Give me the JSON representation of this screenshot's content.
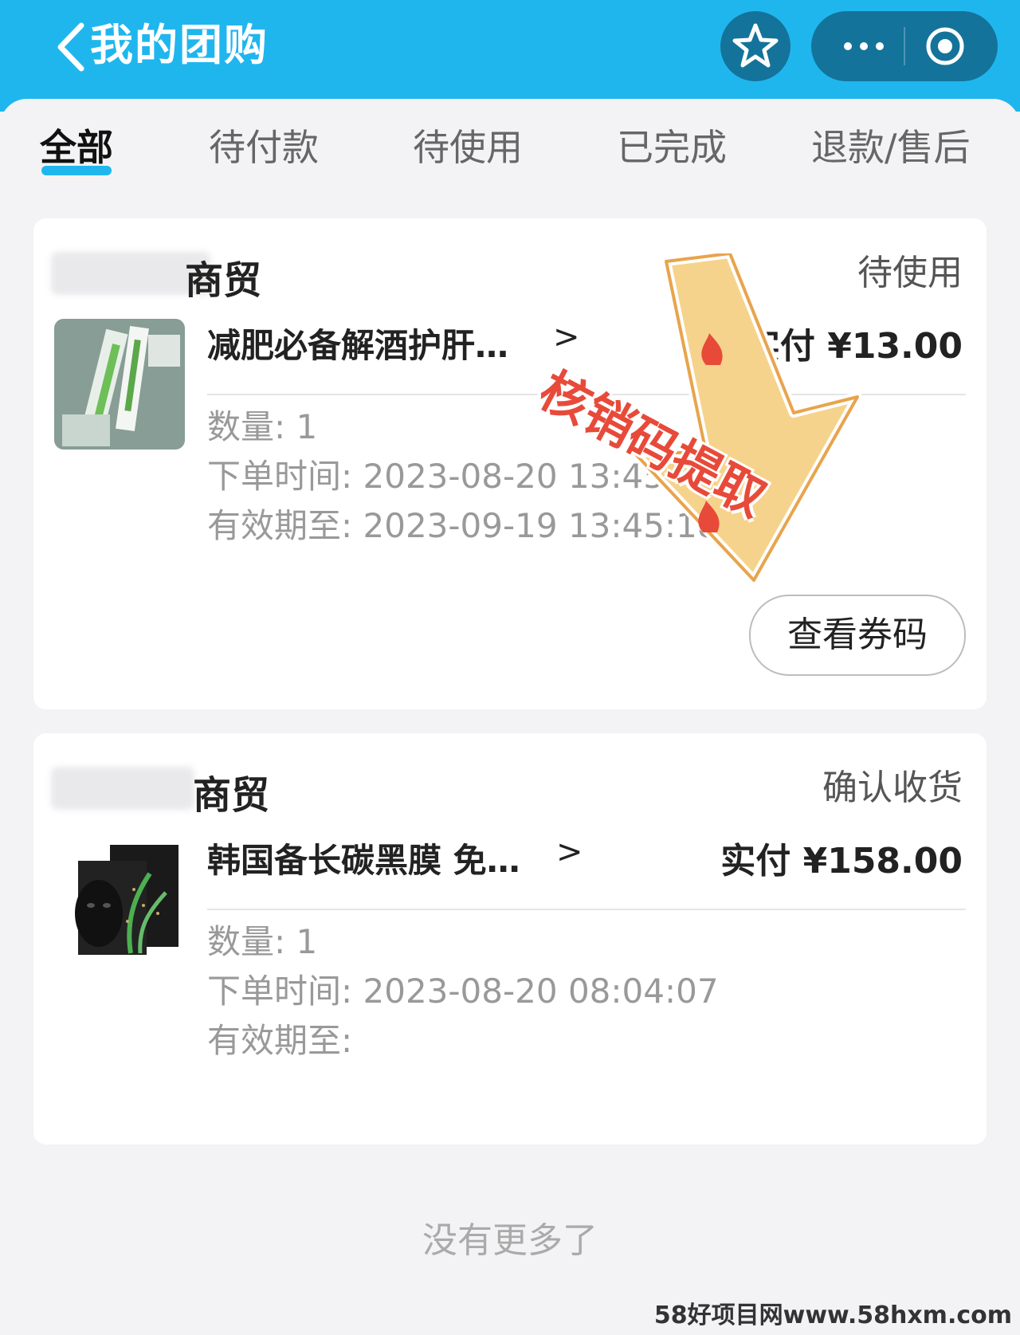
{
  "header": {
    "title": "我的团购",
    "back_icon": "chevron-left-icon",
    "star_icon": "star-icon",
    "more_icon": "more-dots-icon",
    "close_icon": "target-icon",
    "color": "#1fb6ee"
  },
  "tabs": [
    {
      "label": "全部",
      "active": true
    },
    {
      "label": "待付款",
      "active": false
    },
    {
      "label": "待使用",
      "active": false
    },
    {
      "label": "已完成",
      "active": false
    },
    {
      "label": "退款/售后",
      "active": false
    }
  ],
  "orders": [
    {
      "merchant": "商贸",
      "status": "待使用",
      "product": "减肥必备解酒护肝…",
      "price": "实付 ¥13.00",
      "quantity_label": "数量:",
      "quantity": "1",
      "order_time_label": "下单时间:",
      "order_time": "2023-08-20 13:45:",
      "expire_label": "有效期至:",
      "expire": "2023-09-19 13:45:18",
      "button": "查看券码"
    },
    {
      "merchant": "商贸",
      "status": "确认收货",
      "product": "韩国备长碳黑膜 免…",
      "price": "实付 ¥158.00",
      "quantity_label": "数量:",
      "quantity": "1",
      "order_time_label": "下单时间:",
      "order_time": "2023-08-20 08:04:07",
      "expire_label": "有效期至:",
      "expire": ""
    }
  ],
  "footer": {
    "no_more": "没有更多了"
  },
  "sticker": {
    "text": "核销码提取"
  },
  "watermark": "58好项目网www.58hxm.com"
}
